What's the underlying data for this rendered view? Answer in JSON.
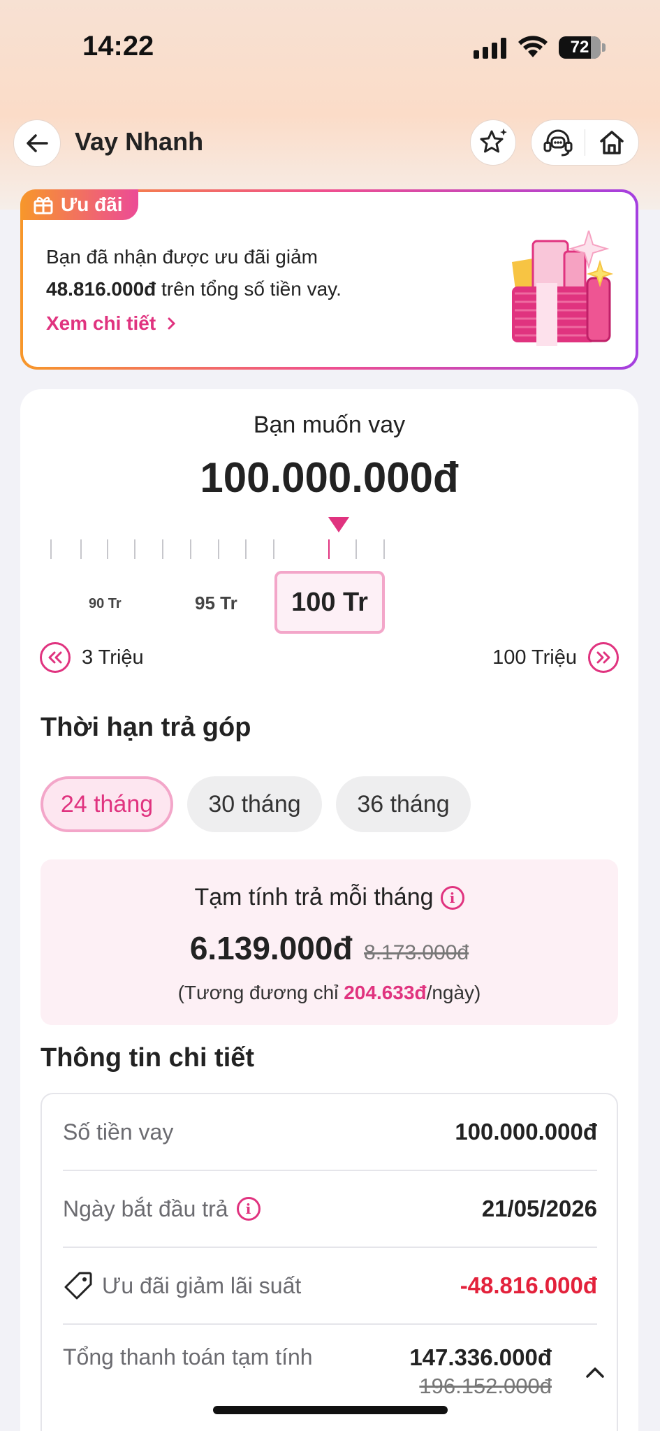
{
  "status_bar": {
    "time": "14:22",
    "battery": "72"
  },
  "header": {
    "title": "Vay Nhanh"
  },
  "promo": {
    "tag": "Ưu đãi",
    "line1": "Bạn đã nhận được ưu đãi giảm",
    "amount": "48.816.000đ",
    "line2_rest": " trên tổng số tiền vay.",
    "link": "Xem chi tiết"
  },
  "loan": {
    "label": "Bạn muốn vay",
    "amount": "100.000.000đ",
    "scale": {
      "left": "90 Tr",
      "mid": "95 Tr",
      "selected": "100 Tr"
    },
    "min_label": "3 Triệu",
    "max_label": "100 Triệu"
  },
  "term": {
    "title": "Thời hạn trả góp",
    "options": [
      "24 tháng",
      "30 tháng",
      "36 tháng"
    ],
    "selected": "24 tháng"
  },
  "estimate": {
    "label": "Tạm tính trả mỗi tháng",
    "value": "6.139.000đ",
    "old_value": "8.173.000đ",
    "daily_prefix": "(Tương đương chỉ ",
    "daily_value": "204.633đ",
    "daily_suffix": "/ngày)"
  },
  "details": {
    "title": "Thông tin chi tiết",
    "rows": [
      {
        "label": "Số tiền vay",
        "value": "100.000.000đ"
      },
      {
        "label": "Ngày bắt đầu trả",
        "value": "21/05/2026"
      },
      {
        "label": "Ưu đãi giảm lãi suất",
        "value": "-48.816.000đ"
      },
      {
        "label": "Tổng thanh toán tạm tính",
        "value": "147.336.000đ",
        "old_value": "196.152.000đ"
      }
    ]
  },
  "colors": {
    "accent": "#e0337f",
    "discount": "#e3213b"
  }
}
